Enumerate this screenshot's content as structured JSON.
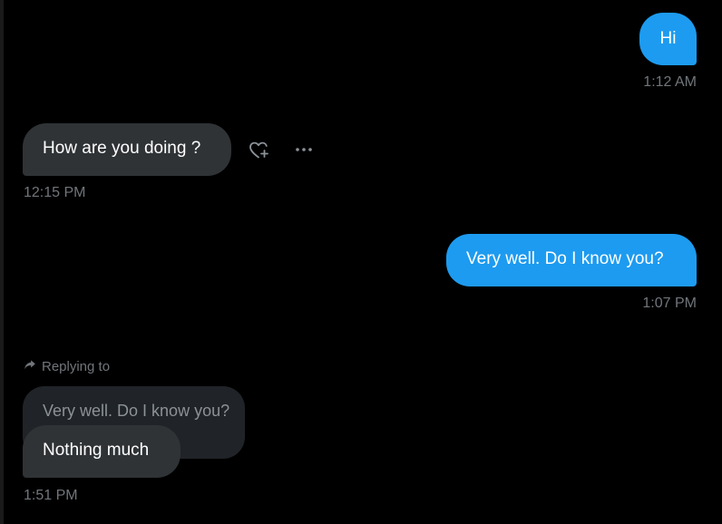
{
  "messages": [
    {
      "id": "m1",
      "text": "Hi",
      "time": "1:12 AM"
    },
    {
      "id": "m2",
      "text": "How are you doing ?",
      "time": "12:15 PM"
    },
    {
      "id": "m3",
      "text": "Very well. Do I know you?",
      "time": "1:07 PM"
    },
    {
      "id": "m4",
      "text": "Nothing much",
      "time": "1:51 PM",
      "reply_label": "Replying to",
      "quoted_text": "Very well. Do I know you?"
    }
  ],
  "icons": {
    "react": "heart-plus-icon",
    "more": "more-horizontal-icon",
    "reply": "reply-arrow-icon"
  },
  "colors": {
    "sent_bubble": "#1d9bf0",
    "received_bubble": "#2f3336",
    "quoted_bubble": "#202327",
    "timestamp": "#71767b",
    "background": "#000000"
  }
}
